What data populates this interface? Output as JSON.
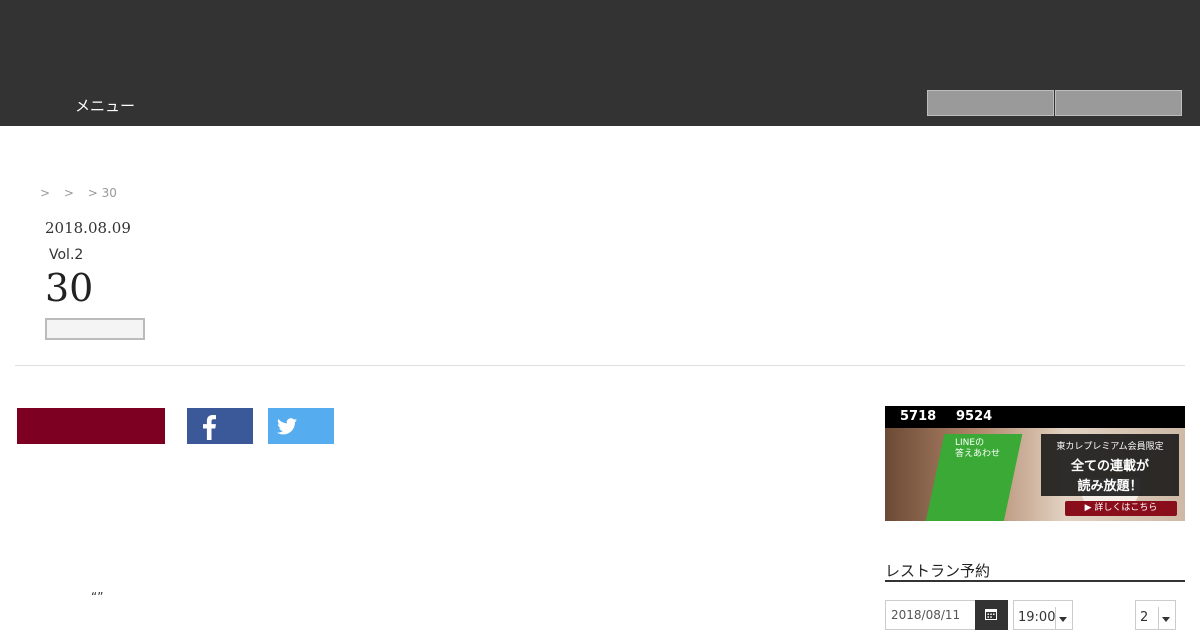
{
  "header": {
    "menu_label": "メニュー",
    "buttons": [
      {
        "label": ""
      },
      {
        "label": ""
      }
    ]
  },
  "breadcrumb": {
    "items": [
      ">",
      ">",
      "> 30"
    ]
  },
  "article": {
    "date": "2018.08.09",
    "vol": "Vol.2",
    "title": "30",
    "body_quote": "“”"
  },
  "share": {
    "facebook_icon": "facebook-icon",
    "twitter_icon": "twitter-icon",
    "colors": {
      "maroon": "#7d0022",
      "facebook": "#3b5998",
      "twitter": "#55acee"
    }
  },
  "sidebar": {
    "counter_a": "5718",
    "counter_b": "9524",
    "banner": {
      "book_title": "LINEの\n答えあわせ",
      "promo_line1": "東カレプレミアム会員限定",
      "promo_line2": "全ての連載が",
      "promo_line3": "読み放題！",
      "cta": "▶ 詳しくはこちら"
    },
    "heading": "レストラン予約",
    "date_value": "2018/08/11",
    "time_value": "19:00",
    "people_value": "2"
  }
}
